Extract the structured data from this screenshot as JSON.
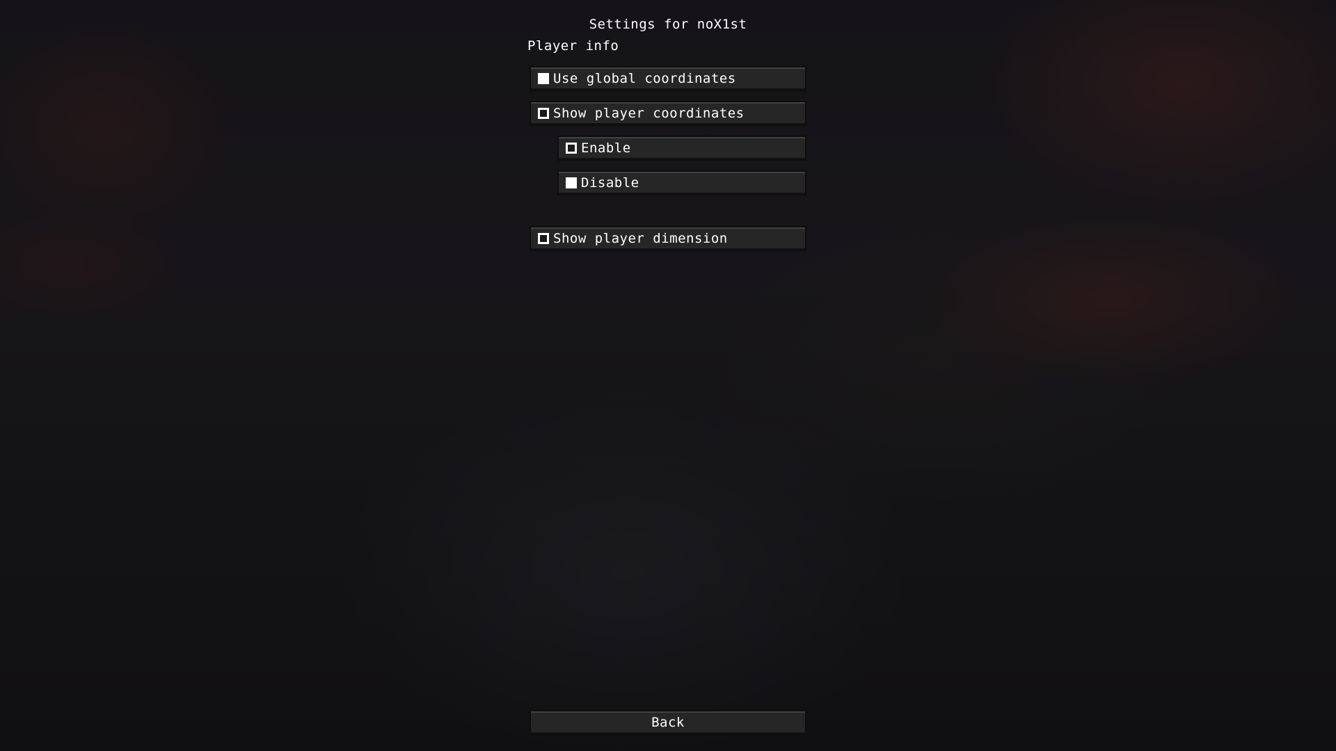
{
  "screen": {
    "title": "Settings for noX1st",
    "section_label": "Player info"
  },
  "options": [
    {
      "label": "Use global coordinates",
      "checked": false
    },
    {
      "label": "Show player coordinates",
      "checked": true
    },
    {
      "label": "Enable",
      "checked": true
    },
    {
      "label": "Disable",
      "checked": false
    },
    {
      "label": "Show player dimension",
      "checked": true
    }
  ],
  "footer": {
    "back_label": "Back"
  },
  "colors": {
    "text": "#ffffff",
    "button_bg": "#282828",
    "button_border": "#0d0d0d"
  },
  "icons": {
    "unchecked": "checkbox-unchecked-icon",
    "checked": "checkbox-checked-icon"
  }
}
